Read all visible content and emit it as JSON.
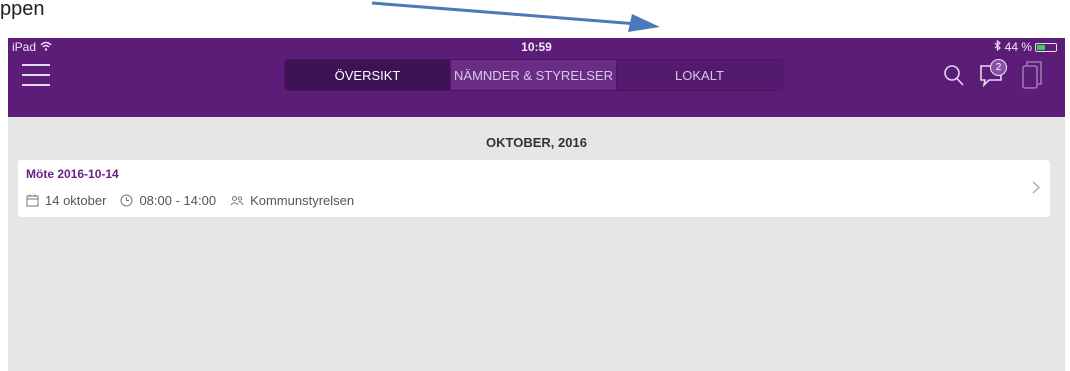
{
  "document": {
    "text": "ppen"
  },
  "status_bar": {
    "device": "iPad",
    "time": "10:59",
    "battery": "44 %",
    "battery_level": 0.44
  },
  "nav": {
    "tabs": [
      {
        "label": "ÖVERSIKT",
        "active": true
      },
      {
        "label": "NÄMNDER & STYRELSER",
        "active": false
      },
      {
        "label": "LOKALT",
        "active": false
      }
    ],
    "notification_count": "2"
  },
  "content": {
    "month_header": "OKTOBER, 2016",
    "meeting": {
      "title": "Möte 2016-10-14",
      "date": "14 oktober",
      "time": "08:00 - 14:00",
      "group": "Kommunstyrelsen"
    }
  },
  "colors": {
    "brand": "#5c1d78",
    "accent_title": "#6a1f8a",
    "background": "#e6e6e6",
    "arrow": "#4a7ab8"
  },
  "icons": [
    "menu-icon",
    "wifi-icon",
    "bluetooth-icon",
    "battery-icon",
    "search-icon",
    "chat-icon",
    "documents-icon",
    "calendar-icon",
    "clock-icon",
    "people-icon",
    "chevron-right-icon"
  ]
}
